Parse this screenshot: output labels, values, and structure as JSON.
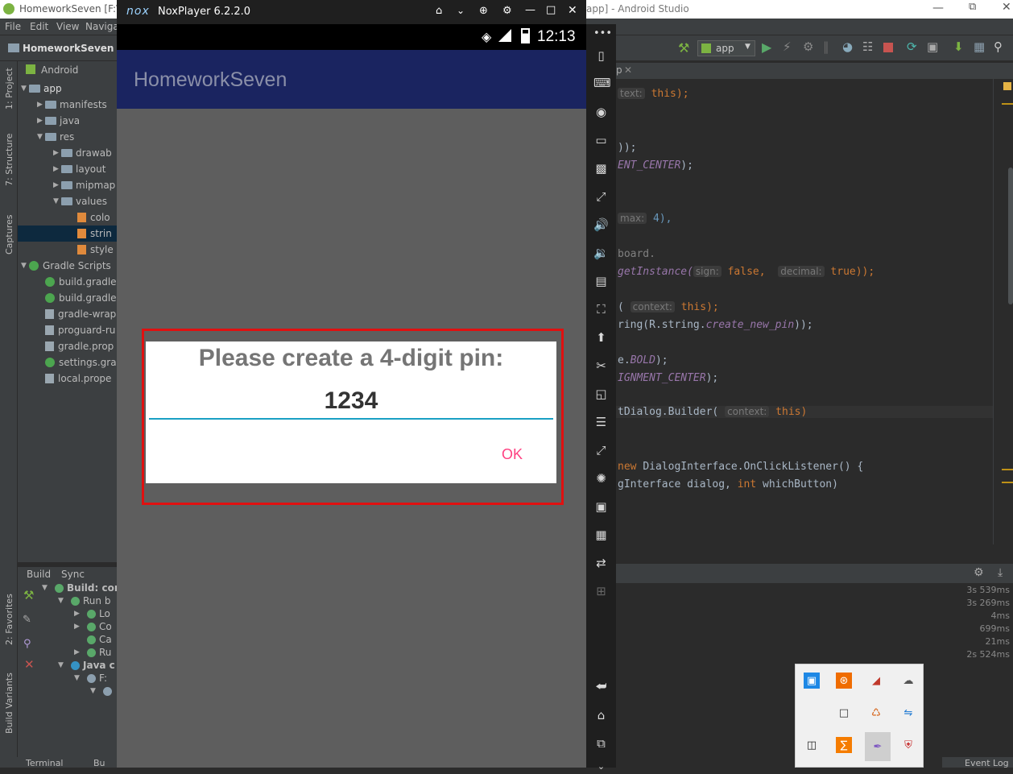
{
  "android_studio": {
    "title_left": "HomeworkSeven [F:\\A",
    "title_right": "app] - Android Studio",
    "menu": [
      "File",
      "Edit",
      "View",
      "Naviga"
    ],
    "breadcrumb": "HomeworkSeven",
    "run_config": "app",
    "left_tabs": [
      "1: Project",
      "7: Structure",
      "Captures",
      "2: Favorites",
      "Build Variants"
    ],
    "project_view_label": "Android",
    "tree": [
      {
        "label": "app",
        "level": 0,
        "kind": "module",
        "expanded": true
      },
      {
        "label": "manifests",
        "level": 1,
        "kind": "folder",
        "expanded": false
      },
      {
        "label": "java",
        "level": 1,
        "kind": "folder",
        "expanded": false
      },
      {
        "label": "res",
        "level": 1,
        "kind": "folder",
        "expanded": true
      },
      {
        "label": "drawab",
        "level": 2,
        "kind": "folder",
        "expanded": false
      },
      {
        "label": "layout",
        "level": 2,
        "kind": "folder",
        "expanded": false
      },
      {
        "label": "mipmap",
        "level": 2,
        "kind": "folder",
        "expanded": false
      },
      {
        "label": "values",
        "level": 2,
        "kind": "folder",
        "expanded": true
      },
      {
        "label": "colo",
        "level": 3,
        "kind": "xml"
      },
      {
        "label": "strin",
        "level": 3,
        "kind": "xml",
        "selected": true
      },
      {
        "label": "style",
        "level": 3,
        "kind": "xml"
      },
      {
        "label": "Gradle Scripts",
        "level": 0,
        "kind": "gradle",
        "expanded": true
      },
      {
        "label": "build.gradle",
        "level": 1,
        "kind": "gradle"
      },
      {
        "label": "build.gradle",
        "level": 1,
        "kind": "gradle"
      },
      {
        "label": "gradle-wrap",
        "level": 1,
        "kind": "file"
      },
      {
        "label": "proguard-ru",
        "level": 1,
        "kind": "file"
      },
      {
        "label": "gradle.prop",
        "level": 1,
        "kind": "file"
      },
      {
        "label": "settings.gra",
        "level": 1,
        "kind": "gradle"
      },
      {
        "label": "local.prope",
        "level": 1,
        "kind": "file"
      }
    ],
    "build_tabs": [
      "Build",
      "Sync"
    ],
    "build_tree": [
      "Build: cor",
      "Run b",
      "Lo",
      "Co",
      "Ca",
      "Ru",
      "Java c",
      "F:",
      ""
    ],
    "build_times": [
      "3s 539ms",
      "3s 269ms",
      "4ms",
      "699ms",
      "21ms",
      "2s 524ms"
    ],
    "bottom_tabs": [
      "Terminal",
      "Bu"
    ],
    "event_log": "Event Log",
    "code": {
      "l1": {
        "hint": "text:",
        "rest": "this);"
      },
      "l2": {
        "pre": "));"
      },
      "l3": {
        "pre": "ENT_CENTER",
        "post": ");"
      },
      "l4": {
        "hint": "max:",
        "num": "4),"
      },
      "l5": {
        "pre": "board."
      },
      "l6": {
        "pre": "getInstance(",
        "hint1": "sign:",
        "v1": "false,",
        "hint2": "decimal:",
        "v2": "true));"
      },
      "l7": {
        "pre": "(",
        "hint": "context:",
        "v": "this);"
      },
      "l8": {
        "pre": "ring(R.string.",
        "it": "create_new_pin",
        "post": "));"
      },
      "l9": {
        "pre": "e.",
        "it": "BOLD",
        "post": ");"
      },
      "l10": {
        "it": "IGNMENT_CENTER",
        "post": ");"
      },
      "l11": {
        "pre": "tDialog.Builder(",
        "hint": "context:",
        "v": "this)"
      },
      "l12": {
        "kw": "new",
        "rest": "DialogInterface.OnClickListener() {"
      },
      "l13": {
        "pre": "gInterface dialog,",
        "kw": "int",
        "rest": "whichButton)"
      }
    }
  },
  "nox": {
    "title": "NoxPlayer 6.2.2.0",
    "logo": "nox",
    "clock": "12:13"
  },
  "app": {
    "title": "HomeworkSeven",
    "dialog": {
      "message": "Please create a 4-digit pin:",
      "pin_value": "1234",
      "ok_label": "OK"
    }
  },
  "colors": {
    "app_bar": "#1a2460",
    "ok_accent": "#ff4081",
    "input_underline": "#1aa0c4",
    "highlight_box": "#e01010"
  }
}
